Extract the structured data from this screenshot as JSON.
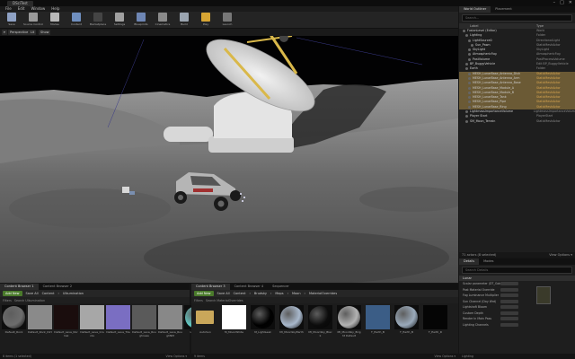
{
  "title_tab": "DSciTest",
  "window_controls": [
    "–",
    "□",
    "✕"
  ],
  "menu": [
    "File",
    "Edit",
    "Window",
    "Help"
  ],
  "toolbar": [
    {
      "label": "Save",
      "icon": "save-icon",
      "color": "#8ea1c4"
    },
    {
      "label": "Source Control",
      "icon": "source-control-icon",
      "color": "#9a9a9a"
    },
    {
      "label": "Modes",
      "icon": "modes-icon",
      "color": "#b8b8b8"
    },
    {
      "label": "Content",
      "icon": "content-icon",
      "color": "#6f8fbf"
    },
    {
      "label": "Marketplace",
      "icon": "marketplace-icon",
      "color": "#444"
    },
    {
      "label": "Settings",
      "icon": "settings-icon",
      "color": "#a0a0a0"
    },
    {
      "label": "Blueprints",
      "icon": "blueprints-icon",
      "color": "#6e86b4"
    },
    {
      "label": "Cinematics",
      "icon": "cinematics-icon",
      "color": "#8a8a8a"
    },
    {
      "label": "Build",
      "icon": "build-icon",
      "color": "#9aa4b0"
    },
    {
      "label": "Play",
      "icon": "play-icon",
      "color": "#d7a533",
      "active": true
    },
    {
      "label": "Launch",
      "icon": "launch-icon",
      "color": "#777"
    }
  ],
  "viewport": {
    "menu_icon": "▾",
    "view_mode": "Perspective",
    "lighting": "Lit",
    "show": "Show"
  },
  "outliner": {
    "tabs": [
      "World Outliner",
      "Placement"
    ],
    "search_placeholder": "Search...",
    "col_label": "Label",
    "col_type": "Type",
    "rows": [
      {
        "label": "FusionLevel (Editor)",
        "type": "World",
        "indent": 0,
        "hl": false
      },
      {
        "label": "Lighting",
        "type": "Folder",
        "indent": 1,
        "hl": false
      },
      {
        "label": "LightSource0",
        "type": "DirectionalLight",
        "indent": 2,
        "hl": false
      },
      {
        "label": "Sun_Pawn",
        "type": "StaticMeshActor",
        "indent": 3,
        "hl": false
      },
      {
        "label": "SkyLight",
        "type": "SkyLight",
        "indent": 2,
        "hl": false
      },
      {
        "label": "AtmosphericFog",
        "type": "AtmosphericFog",
        "indent": 2,
        "hl": false
      },
      {
        "label": "PostVolume",
        "type": "PostProcessVolume",
        "indent": 2,
        "hl": false
      },
      {
        "label": "BP_BuggyVehicle",
        "type": "Edit BP_BuggyVehicle",
        "indent": 1,
        "hl": false
      },
      {
        "label": "Earth",
        "type": "Folder",
        "indent": 1,
        "hl": false
      },
      {
        "label": "MESH_LunarBase_Antenna_Dish",
        "type": "StaticMeshActor",
        "indent": 2,
        "hl": true
      },
      {
        "label": "MESH_LunarBase_Antenna_Arm",
        "type": "StaticMeshActor",
        "indent": 2,
        "hl": true
      },
      {
        "label": "MESH_LunarBase_Antenna_Base",
        "type": "StaticMeshActor",
        "indent": 2,
        "hl": true
      },
      {
        "label": "MESH_LunarBase_Module_A",
        "type": "StaticMeshActor",
        "indent": 2,
        "hl": true
      },
      {
        "label": "MESH_LunarBase_Module_B",
        "type": "StaticMeshActor",
        "indent": 2,
        "hl": true
      },
      {
        "label": "MESH_LunarBase_Tank",
        "type": "StaticMeshActor",
        "indent": 2,
        "hl": true
      },
      {
        "label": "MESH_LunarBase_Pipe",
        "type": "StaticMeshActor",
        "indent": 2,
        "hl": true
      },
      {
        "label": "MESH_LunarBase_Ring",
        "type": "StaticMeshActor",
        "indent": 2,
        "hl": true
      },
      {
        "label": "LightmassImportanceVolume",
        "type": "LightmassImportanceVolume",
        "indent": 1,
        "hl": false
      },
      {
        "label": "Player Start",
        "type": "PlayerStart",
        "indent": 1,
        "hl": false
      },
      {
        "label": "SM_Moon_Terrain",
        "type": "StaticMeshActor",
        "indent": 1,
        "hl": false
      }
    ],
    "footer_left": "71 actors (8 selected)",
    "footer_right": "View Options ▾"
  },
  "details": {
    "tabs": [
      "Details",
      "Modes"
    ],
    "search_placeholder": "Search Details",
    "section_title": "Lunar",
    "rows": [
      {
        "key": "Scalar parameter (DT_Gold)",
        "val": ""
      },
      {
        "key": "Post Material Override",
        "val": ""
      },
      {
        "key": "Fog Luminance Multiplier",
        "val": ""
      },
      {
        "key": "Sun Channel (Day Wrd)",
        "val": ""
      },
      {
        "key": "Lightshaft Bloom",
        "val": ""
      },
      {
        "key": "Custom Depth",
        "val": ""
      },
      {
        "key": "Render In Main Pass",
        "val": ""
      },
      {
        "key": "Lighting Channels",
        "val": ""
      }
    ],
    "footer": "Lighting"
  },
  "content_browser_1": {
    "tabs": [
      "Content Browser 1",
      "Content Browser 2"
    ],
    "add_new": "Add New",
    "save_all": "Save All",
    "path": [
      "Content",
      "Ulkumination"
    ],
    "filters": "Filters",
    "search": "Search Ulkumination",
    "assets": [
      {
        "name": "Default_Rock",
        "color": "#6d6d6d",
        "shape": "sphere"
      },
      {
        "name": "Default_Rock_Dirt",
        "color": "#8a8a8a",
        "shape": "square"
      },
      {
        "name": "Default_Lava_Normal",
        "color": "#1a0d0d",
        "shape": "square"
      },
      {
        "name": "Default_Lava_Cracks",
        "color": "#a7a7a7",
        "shape": "square"
      },
      {
        "name": "Default_Lava_Tile",
        "color": "#7a6ec2",
        "shape": "square"
      },
      {
        "name": "Default_Lava_Roughness",
        "color": "#5a5a5a",
        "shape": "square"
      },
      {
        "name": "Default_Lava_RoughNM",
        "color": "#888",
        "shape": "square"
      },
      {
        "name": "Lightblue",
        "color": "#61c9c4",
        "shape": "sphere"
      }
    ],
    "footer_left": "8 items (1 selected)",
    "footer_right": "View Options ▾"
  },
  "content_browser_2": {
    "tabs": [
      "Content Browser 3",
      "Content Browser 4",
      "Sequencer"
    ],
    "add_new": "Add New",
    "save_all": "Save All",
    "path": [
      "Content",
      "Brudsky",
      "Maps",
      "Moon",
      "MaterialOverrides"
    ],
    "filters": "Filters",
    "search": "Search MaterialOverrides",
    "assets": [
      {
        "name": "AutoSun",
        "color": "#c9a75a",
        "shape": "folder"
      },
      {
        "name": "M_MoonWhite",
        "color": "#ffffff",
        "shape": "square"
      },
      {
        "name": "M_LightLeak",
        "color": "#000000",
        "shape": "circle"
      },
      {
        "name": "MI_MoonSkyEarth",
        "color": "#a8b8cc",
        "shape": "circle"
      },
      {
        "name": "MI_MoonSky_Black",
        "color": "#0c0c0c",
        "shape": "circle"
      },
      {
        "name": "MI_MoonSky_Bright Default",
        "color": "#b3b3b3",
        "shape": "circle"
      },
      {
        "name": "T_Earth_B",
        "color": "#3b5d86",
        "shape": "square"
      },
      {
        "name": "T_Earth_B",
        "color": "#9aaabb",
        "shape": "circle"
      },
      {
        "name": "T_Earth_D",
        "color": "#050505",
        "shape": "square"
      }
    ],
    "footer_left": "9 items",
    "footer_right": "View Options ▾"
  }
}
